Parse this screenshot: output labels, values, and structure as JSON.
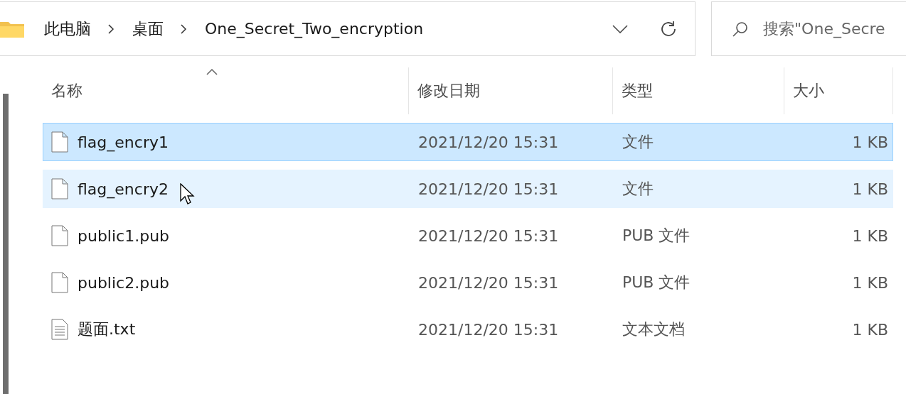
{
  "address_bar": {
    "path": [
      "此电脑",
      "桌面",
      "One_Secret_Two_encryption"
    ]
  },
  "search": {
    "placeholder": "搜索\"One_Secre"
  },
  "table": {
    "columns": [
      {
        "label": "名称",
        "sorted": true
      },
      {
        "label": "修改日期",
        "sorted": false
      },
      {
        "label": "类型",
        "sorted": false
      },
      {
        "label": "大小",
        "sorted": false
      }
    ],
    "rows": [
      {
        "kind": "file",
        "name": "flag_encry1",
        "date": "2021/12/20 15:31",
        "type": "文件",
        "size": "1 KB",
        "selected": true,
        "hovered": false
      },
      {
        "kind": "file",
        "name": "flag_encry2",
        "date": "2021/12/20 15:31",
        "type": "文件",
        "size": "1 KB",
        "selected": false,
        "hovered": true
      },
      {
        "kind": "file",
        "name": "public1.pub",
        "date": "2021/12/20 15:31",
        "type": "PUB 文件",
        "size": "1 KB",
        "selected": false,
        "hovered": false
      },
      {
        "kind": "file",
        "name": "public2.pub",
        "date": "2021/12/20 15:31",
        "type": "PUB 文件",
        "size": "1 KB",
        "selected": false,
        "hovered": false
      },
      {
        "kind": "text",
        "name": "题面.txt",
        "date": "2021/12/20 15:31",
        "type": "文本文档",
        "size": "1 KB",
        "selected": false,
        "hovered": false
      }
    ]
  }
}
